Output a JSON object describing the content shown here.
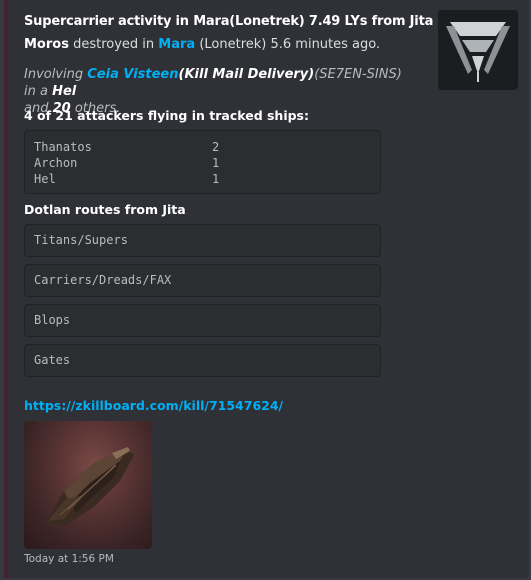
{
  "embed": {
    "accent_color": "#4a1d36",
    "title": "Supercarrier activity in Mara(Lonetrek) 7.49 LYs from Jita",
    "description": {
      "ship": "Moros",
      "mid1": " destroyed in ",
      "system": "Mara",
      "mid2": " (Lonetrek) 5.6 minutes ago."
    },
    "involving": {
      "prefix": "Involving ",
      "pilot": "Ceia Visteen",
      "corp": "(Kill Mail Delivery)",
      "alliance": "(SE7EN-SINS)",
      "mid": " in a ",
      "ship": "Hel",
      "and": " and ",
      "count": "20",
      "suffix": " others."
    },
    "thumbnail_icon": "alliance-logo-icon",
    "attackers_field": {
      "name": "4 of 21 attackers flying in tracked ships:",
      "rows": [
        {
          "ship": "Thanatos",
          "count": "2"
        },
        {
          "ship": "Archon",
          "count": "1"
        },
        {
          "ship": "Hel",
          "count": "1"
        }
      ]
    },
    "routes_field": {
      "name": "Dotlan routes from Jita",
      "routes": [
        "Titans/Supers",
        "Carriers/Dreads/FAX",
        "Blops",
        "Gates"
      ]
    },
    "zkill_link": "https://zkillboard.com/kill/71547624/",
    "image_icon": "ship-render-image",
    "footer": "Today at 1:56 PM"
  }
}
